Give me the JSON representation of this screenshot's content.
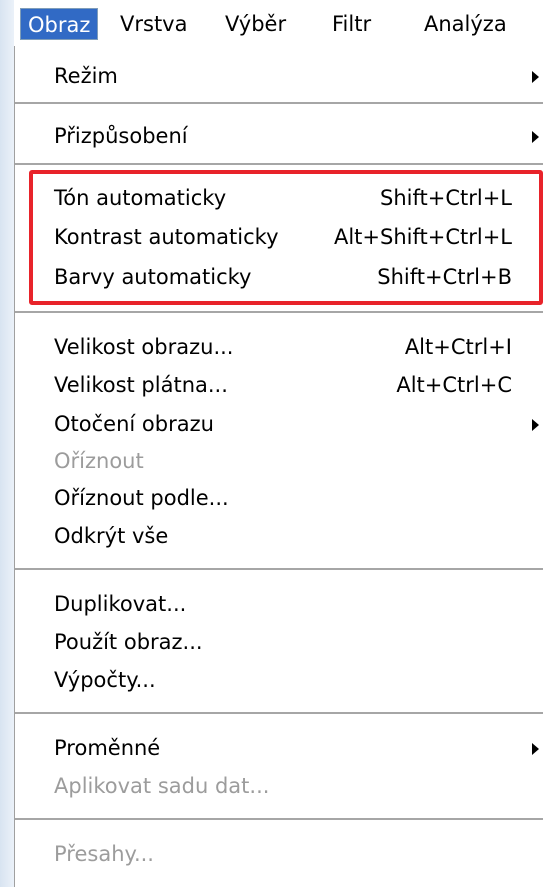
{
  "menubar": {
    "items": [
      {
        "label": "Obraz",
        "active": true
      },
      {
        "label": "Vrstva"
      },
      {
        "label": "Výběr"
      },
      {
        "label": "Filtr"
      },
      {
        "label": "Analýza"
      }
    ]
  },
  "menu": {
    "items": [
      {
        "label": "Režim",
        "submenu": true
      },
      {
        "label": "Přizpůsobení",
        "submenu": true
      },
      {
        "label": "Tón automaticky",
        "shortcut": "Shift+Ctrl+L"
      },
      {
        "label": "Kontrast automaticky",
        "shortcut": "Alt+Shift+Ctrl+L"
      },
      {
        "label": "Barvy automaticky",
        "shortcut": "Shift+Ctrl+B"
      },
      {
        "label": "Velikost obrazu...",
        "shortcut": "Alt+Ctrl+I"
      },
      {
        "label": "Velikost plátna...",
        "shortcut": "Alt+Ctrl+C"
      },
      {
        "label": "Otočení obrazu",
        "submenu": true
      },
      {
        "label": "Oříznout",
        "disabled": true
      },
      {
        "label": "Oříznout podle..."
      },
      {
        "label": "Odkrýt vše"
      },
      {
        "label": "Duplikovat..."
      },
      {
        "label": "Použít obraz..."
      },
      {
        "label": "Výpočty..."
      },
      {
        "label": "Proměnné",
        "submenu": true
      },
      {
        "label": "Aplikovat sadu dat...",
        "disabled": true
      },
      {
        "label": "Přesahy...",
        "disabled": true
      }
    ]
  },
  "colors": {
    "active_menu_bg": "#316ac5",
    "highlight_border": "#e8232a",
    "disabled_text": "#9c9c9c"
  }
}
